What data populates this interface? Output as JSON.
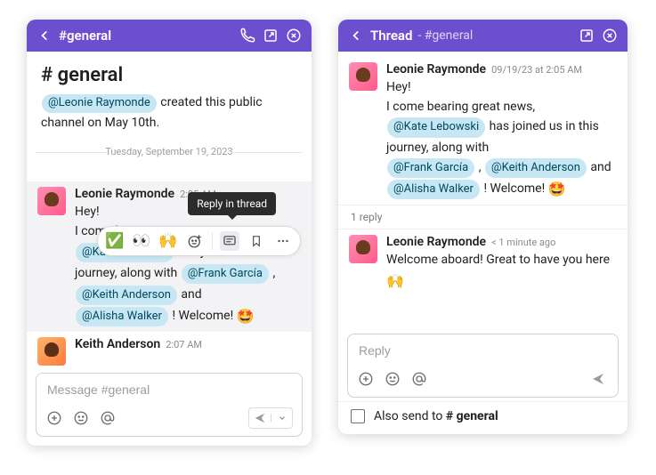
{
  "left": {
    "header": {
      "channel": "#general"
    },
    "channel_title": "# general",
    "created_by_mention": "@Leonie Raymonde",
    "created_text_suffix": "  created this public channel on May 10th.",
    "date_divider": "Tuesday, September 19, 2023",
    "tooltip": "Reply in thread",
    "toolbar_emojis": {
      "check": "✅",
      "eyes": "👀",
      "hands": "🙌"
    },
    "msg1": {
      "author": "Leonie Raymonde",
      "time": "2:05 AM",
      "l1": "Hey!",
      "l2a": "I come bearing great news, ",
      "m_kate": "@Kate Lebowski",
      "l2b": "  has joined us in this journey, along with ",
      "m_frank": "@Frank García",
      "comma": " , ",
      "m_keith": "@Keith Anderson",
      "and": "   and ",
      "m_alisha": "@Alisha Walker",
      "welcome": " ! Welcome! ",
      "emoji": "🤩"
    },
    "msg2": {
      "author": "Keith Anderson",
      "time": "2:07 AM"
    },
    "composer_placeholder": "Message #general"
  },
  "right": {
    "header": {
      "title": "Thread",
      "sub": " - #general"
    },
    "msg1": {
      "author": "Leonie Raymonde",
      "time": "09/19/23 at 2:05 AM",
      "l1": "Hey!",
      "l2a": "I come bearing great news, ",
      "m_kate": "@Kate Lebowski",
      "l2b": "  has joined us in this journey, along with ",
      "m_frank": "@Frank García",
      "comma": " , ",
      "m_keith": "@Keith Anderson",
      "and": " and ",
      "m_alisha": "@Alisha Walker",
      "welcome": " ! Welcome! ",
      "emoji": "🤩"
    },
    "reply_count": "1 reply",
    "msg2": {
      "author": "Leonie Raymonde",
      "time": "< 1 minute ago",
      "text": "Welcome aboard! Great to have you here ",
      "emoji": "🙌"
    },
    "composer_placeholder": "Reply",
    "also_send_prefix": "Also send to ",
    "also_send_channel": "# general"
  }
}
